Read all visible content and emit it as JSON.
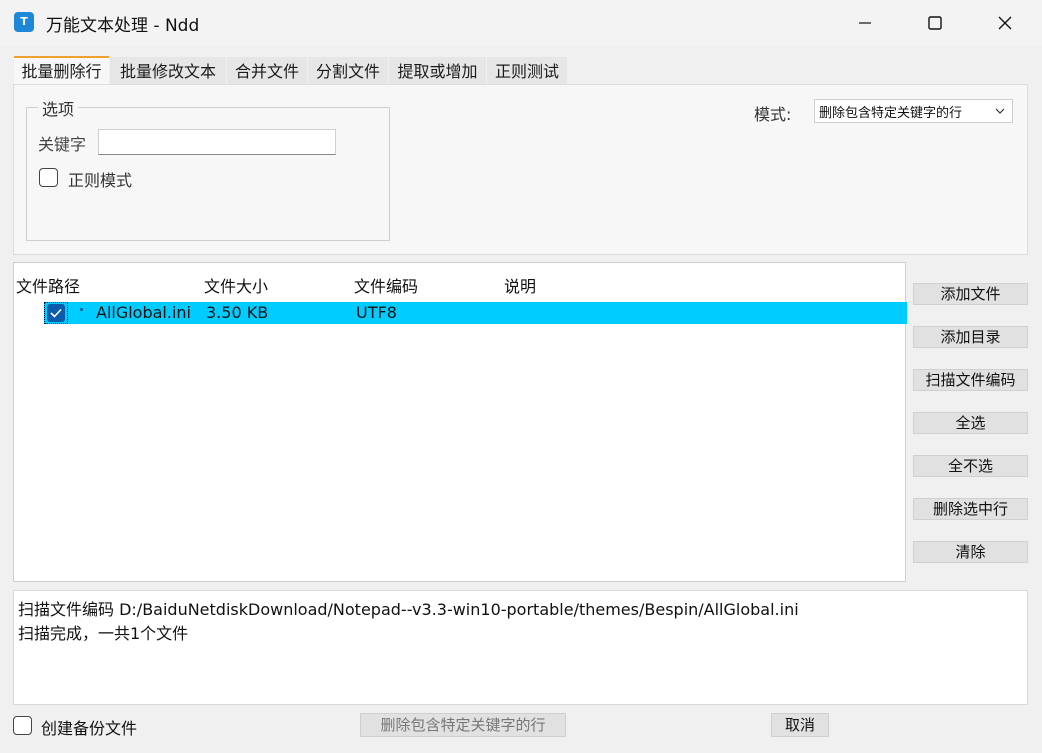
{
  "window": {
    "title": "万能文本处理 - Ndd",
    "icon_letter": "T",
    "accent": "#1e88d8"
  },
  "tabs": [
    {
      "label": "批量删除行",
      "active": true
    },
    {
      "label": "批量修改文本",
      "active": false
    },
    {
      "label": "合并文件",
      "active": false
    },
    {
      "label": "分割文件",
      "active": false
    },
    {
      "label": "提取或增加",
      "active": false
    },
    {
      "label": "正则测试",
      "active": false
    }
  ],
  "options": {
    "group_title": "选项",
    "keyword_label": "关键字",
    "keyword_value": "",
    "regex_label": "正则模式",
    "regex_checked": false,
    "mode_label": "模式:",
    "mode_selected": "删除包含特定关键字的行"
  },
  "filelist": {
    "headers": [
      "文件路径",
      "文件大小",
      "文件编码",
      "说明"
    ],
    "rows": [
      {
        "checked": true,
        "path": "AllGlobal.ini",
        "size": "3.50 KB",
        "encoding": "UTF8",
        "note": ""
      }
    ],
    "selected_color": "#00ccff"
  },
  "side_buttons": [
    "添加文件",
    "添加目录",
    "扫描文件编码",
    "全选",
    "全不选",
    "删除选中行",
    "清除"
  ],
  "log": [
    "扫描文件编码 D:/BaiduNetdiskDownload/Notepad--v3.3-win10-portable/themes/Bespin/AllGlobal.ini",
    "扫描完成，一共1个文件"
  ],
  "bottom": {
    "backup_label": "创建备份文件",
    "backup_checked": false,
    "run_label": "删除包含特定关键字的行",
    "cancel_label": "取消"
  }
}
